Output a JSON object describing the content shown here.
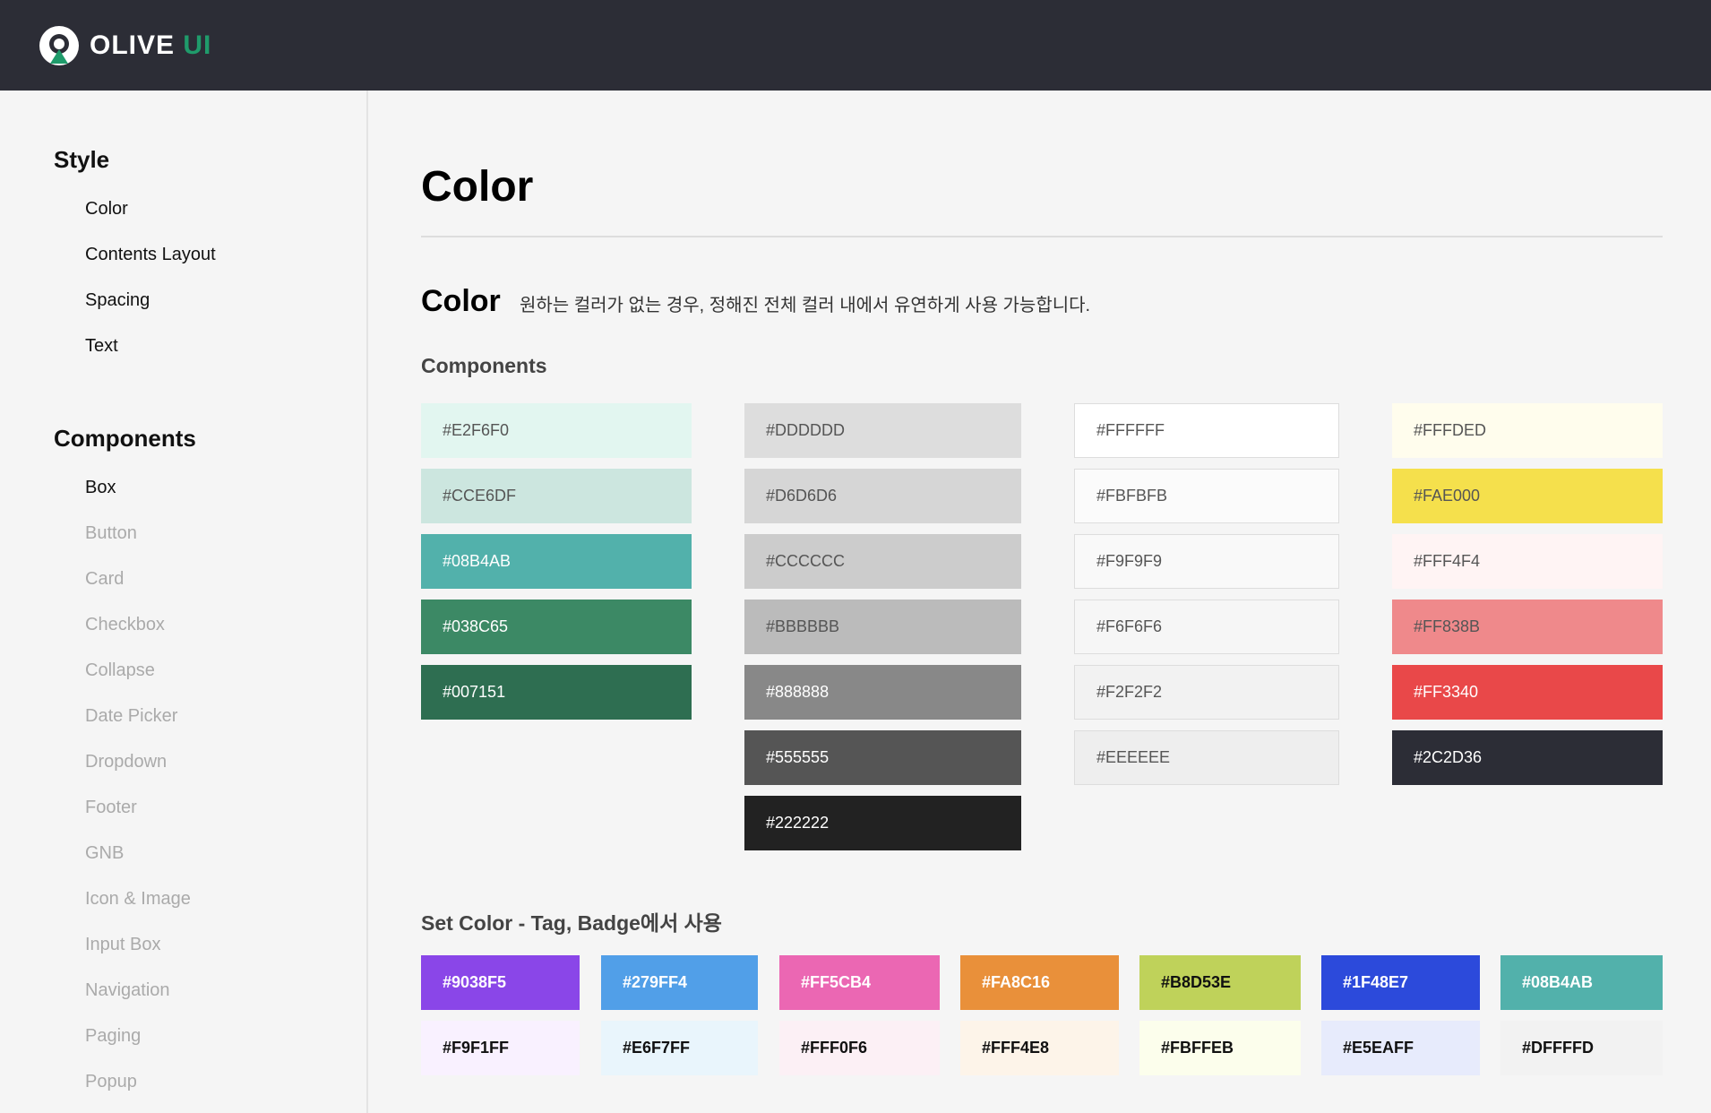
{
  "header": {
    "logo_text": "OLIVE",
    "logo_accent": "UI",
    "brand_color": "#1f9b6b",
    "bg_color": "#2c2d36"
  },
  "sidebar": {
    "groups": [
      {
        "title": "Style",
        "items": [
          "Color",
          "Contents Layout",
          "Spacing",
          "Text"
        ]
      },
      {
        "title": "Components",
        "items": [
          "Box",
          "Button",
          "Card",
          "Checkbox",
          "Collapse",
          "Date Picker",
          "Dropdown",
          "Footer",
          "GNB",
          "Icon & Image",
          "Input Box",
          "Navigation",
          "Paging",
          "Popup"
        ]
      }
    ]
  },
  "main": {
    "page_title": "Color",
    "section_title": "Color",
    "section_desc": "원하는 컬러가 없는 경우, 정해진 전체 컬러 내에서 유연하게 사용 가능합니다.",
    "components_title": "Components",
    "set_title": "Set Color - Tag, Badge에서 사용"
  },
  "palette_columns": [
    [
      {
        "label": "#E2F6F0",
        "bg": "#E2F6F0",
        "fg": "#555555"
      },
      {
        "label": "#CCE6DF",
        "bg": "#CCE6DF",
        "fg": "#555555"
      },
      {
        "label": "#08B4AB",
        "bg": "#52B1AB",
        "fg": "#ffffff"
      },
      {
        "label": "#038C65",
        "bg": "#3C8965",
        "fg": "#ffffff"
      },
      {
        "label": "#007151",
        "bg": "#2E6E51",
        "fg": "#ffffff"
      }
    ],
    [
      {
        "label": "#DDDDDD",
        "bg": "#DDDDDD",
        "fg": "#555555"
      },
      {
        "label": "#D6D6D6",
        "bg": "#D6D6D6",
        "fg": "#555555"
      },
      {
        "label": "#CCCCCC",
        "bg": "#CCCCCC",
        "fg": "#555555"
      },
      {
        "label": "#BBBBBB",
        "bg": "#BBBBBB",
        "fg": "#555555"
      },
      {
        "label": "#888888",
        "bg": "#888888",
        "fg": "#ffffff"
      },
      {
        "label": "#555555",
        "bg": "#555555",
        "fg": "#ffffff"
      },
      {
        "label": "#222222",
        "bg": "#222222",
        "fg": "#ffffff"
      }
    ],
    [
      {
        "label": "#FFFFFF",
        "bg": "#FFFFFF",
        "fg": "#555555",
        "border": "#dddddd"
      },
      {
        "label": "#FBFBFB",
        "bg": "#FBFBFB",
        "fg": "#555555",
        "border": "#dddddd"
      },
      {
        "label": "#F9F9F9",
        "bg": "#F9F9F9",
        "fg": "#555555",
        "border": "#dddddd"
      },
      {
        "label": "#F6F6F6",
        "bg": "#F6F6F6",
        "fg": "#555555",
        "border": "#dddddd"
      },
      {
        "label": "#F2F2F2",
        "bg": "#F2F2F2",
        "fg": "#555555",
        "border": "#dddddd"
      },
      {
        "label": "#EEEEEE",
        "bg": "#EEEEEE",
        "fg": "#555555",
        "border": "#dddddd"
      }
    ],
    [
      {
        "label": "#FFFDED",
        "bg": "#FFFDED",
        "fg": "#555555"
      },
      {
        "label": "#FAE000",
        "bg": "#F5E04C",
        "fg": "#555555"
      },
      {
        "label": "#FFF4F4",
        "bg": "#FFF4F4",
        "fg": "#555555"
      },
      {
        "label": "#FF838B",
        "bg": "#EF898B",
        "fg": "#555555"
      },
      {
        "label": "#FF3340",
        "bg": "#E94849",
        "fg": "#ffffff"
      },
      {
        "label": "#2C2D36",
        "bg": "#2C2D36",
        "fg": "#ffffff"
      }
    ]
  ],
  "set_colors": [
    {
      "strong": {
        "label": "#9038F5",
        "bg": "#8A46E8",
        "fg": "#ffffff"
      },
      "light": {
        "label": "#F9F1FF",
        "bg": "#F9F1FF",
        "fg": "#111111"
      }
    },
    {
      "strong": {
        "label": "#279FF4",
        "bg": "#519FE8",
        "fg": "#ffffff"
      },
      "light": {
        "label": "#E6F7FF",
        "bg": "#E9F5FC",
        "fg": "#111111"
      }
    },
    {
      "strong": {
        "label": "#FF5CB4",
        "bg": "#EB67B3",
        "fg": "#ffffff"
      },
      "light": {
        "label": "#FFF0F6",
        "bg": "#FCF0F5",
        "fg": "#111111"
      }
    },
    {
      "strong": {
        "label": "#FA8C16",
        "bg": "#E9903A",
        "fg": "#ffffff"
      },
      "light": {
        "label": "#FFF4E8",
        "bg": "#FDF4E9",
        "fg": "#111111"
      }
    },
    {
      "strong": {
        "label": "#B8D53E",
        "bg": "#BFD25A",
        "fg": "#111111"
      },
      "light": {
        "label": "#FBFFEB",
        "bg": "#FCFEEC",
        "fg": "#111111"
      }
    },
    {
      "strong": {
        "label": "#1F48E7",
        "bg": "#2C4ADB",
        "fg": "#ffffff"
      },
      "light": {
        "label": "#E5EAFF",
        "bg": "#E7EBFC",
        "fg": "#111111"
      }
    },
    {
      "strong": {
        "label": "#08B4AB",
        "bg": "#52B1AB",
        "fg": "#ffffff"
      },
      "light": {
        "label": "#DFFFFD",
        "bg": "#F2F2F2",
        "fg": "#111111"
      }
    }
  ]
}
